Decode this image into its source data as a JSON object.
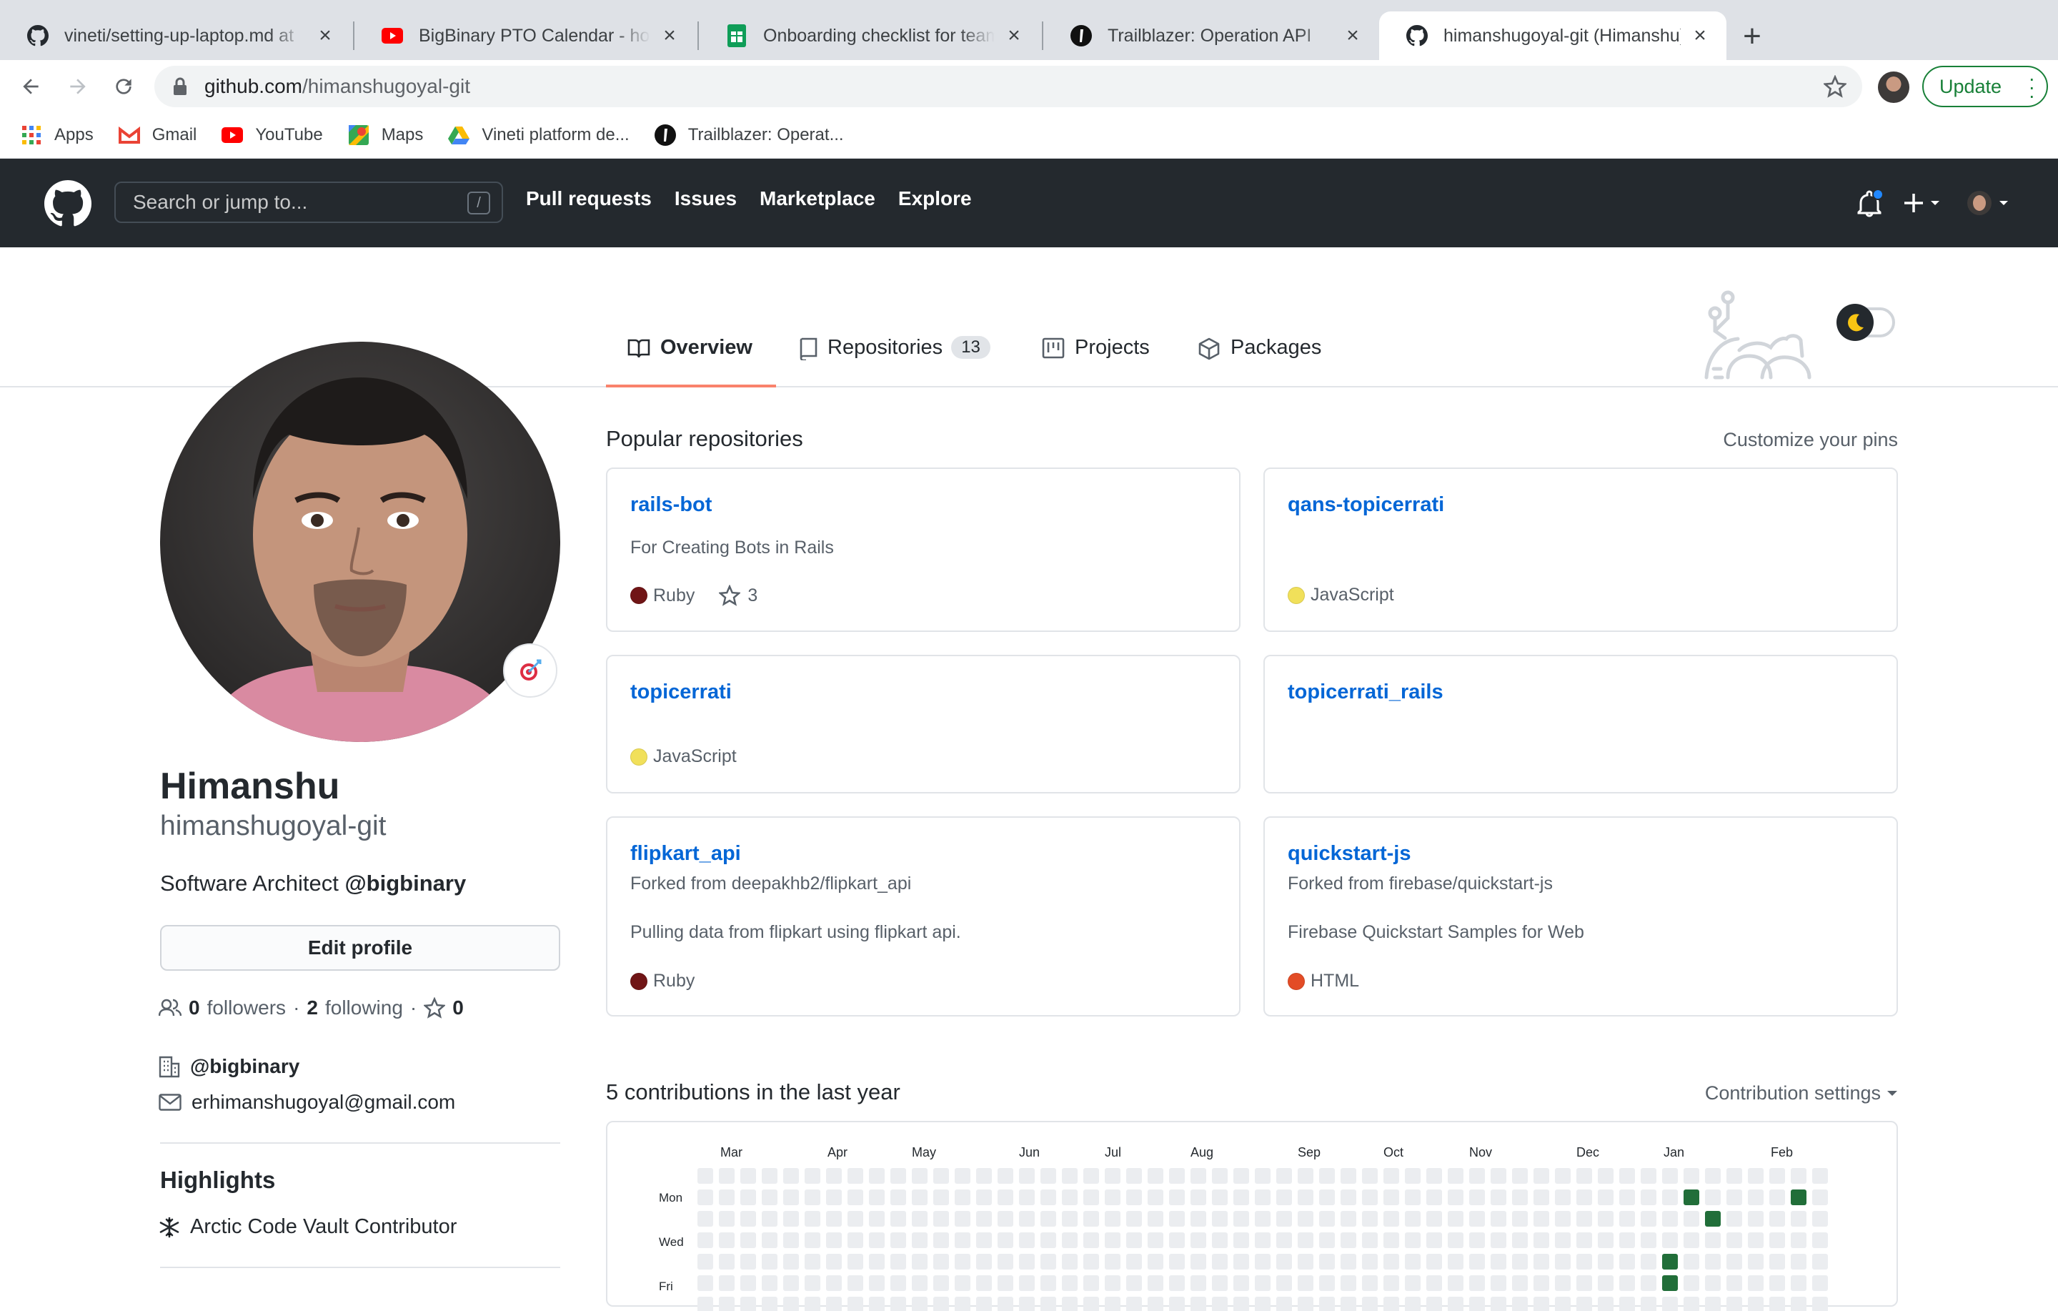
{
  "browser": {
    "tabs": [
      {
        "title": "vineti/setting-up-laptop.md at",
        "icon": "github-icon"
      },
      {
        "title": "BigBinary PTO Calendar - how",
        "icon": "youtube-icon"
      },
      {
        "title": "Onboarding checklist for team",
        "icon": "sheets-icon"
      },
      {
        "title": "Trailblazer: Operation API",
        "icon": "trailblazer-icon"
      },
      {
        "title": "himanshugoyal-git (Himanshu)",
        "icon": "github-icon",
        "active": true
      }
    ],
    "url_host": "github.com",
    "url_path": "/himanshugoyal-git",
    "update_label": "Update",
    "bookmarks": [
      {
        "label": "Apps",
        "icon": "apps-grid-icon"
      },
      {
        "label": "Gmail",
        "icon": "gmail-icon"
      },
      {
        "label": "YouTube",
        "icon": "youtube-icon"
      },
      {
        "label": "Maps",
        "icon": "maps-icon"
      },
      {
        "label": "Vineti platform de...",
        "icon": "drive-icon"
      },
      {
        "label": "Trailblazer: Operat...",
        "icon": "trailblazer-icon"
      }
    ]
  },
  "github": {
    "search_placeholder": "Search or jump to...",
    "search_shortcut": "/",
    "nav": [
      "Pull requests",
      "Issues",
      "Marketplace",
      "Explore"
    ]
  },
  "profile_tabs": {
    "overview": "Overview",
    "repositories": "Repositories",
    "repositories_count": "13",
    "projects": "Projects",
    "packages": "Packages"
  },
  "profile": {
    "name": "Himanshu",
    "login": "himanshugoyal-git",
    "bio_prefix": "Software Architect ",
    "bio_org": "@bigbinary",
    "edit_label": "Edit profile",
    "followers_count": "0",
    "followers_label": "followers",
    "sep": "·",
    "following_count": "2",
    "following_label": "following",
    "stars_count": "0",
    "org": "@bigbinary",
    "email": "erhimanshugoyal@gmail.com",
    "highlights_title": "Highlights",
    "highlight_item": "Arctic Code Vault Contributor"
  },
  "popular": {
    "title": "Popular repositories",
    "customize": "Customize your pins",
    "repos": [
      {
        "name": "rails-bot",
        "fork": "",
        "desc": "For Creating Bots in Rails",
        "lang": "Ruby",
        "lang_color": "#701516",
        "stars": "3"
      },
      {
        "name": "qans-topicerrati",
        "fork": "",
        "desc": "",
        "lang": "JavaScript",
        "lang_color": "#f1e05a",
        "stars": ""
      },
      {
        "name": "topicerrati",
        "fork": "",
        "desc": "",
        "lang": "JavaScript",
        "lang_color": "#f1e05a",
        "stars": ""
      },
      {
        "name": "topicerrati_rails",
        "fork": "",
        "desc": "",
        "lang": "",
        "lang_color": "",
        "stars": ""
      },
      {
        "name": "flipkart_api",
        "fork": "Forked from deepakhb2/flipkart_api",
        "desc": "Pulling data from flipkart using flipkart api.",
        "lang": "Ruby",
        "lang_color": "#701516",
        "stars": ""
      },
      {
        "name": "quickstart-js",
        "fork": "Forked from firebase/quickstart-js",
        "desc": "Firebase Quickstart Samples for Web",
        "lang": "HTML",
        "lang_color": "#e34c26",
        "stars": ""
      }
    ]
  },
  "contributions": {
    "title": "5 contributions in the last year",
    "settings": "Contribution settings",
    "months": [
      "Mar",
      "Apr",
      "May",
      "Jun",
      "Jul",
      "Aug",
      "Sep",
      "Oct",
      "Nov",
      "Dec",
      "Jan",
      "Feb"
    ],
    "days": [
      "Mon",
      "Wed",
      "Fri"
    ],
    "active_cells": [
      {
        "week": 46,
        "day": 1
      },
      {
        "week": 47,
        "day": 2
      },
      {
        "week": 45,
        "day": 4
      },
      {
        "week": 45,
        "day": 5
      },
      {
        "week": 51,
        "day": 1
      }
    ],
    "colors": {
      "empty": "#ebedf0",
      "active": "#216e39"
    }
  },
  "colors": {
    "accent_tab": "#f9826c",
    "link": "#0366d6",
    "header_bg": "#24292e"
  }
}
